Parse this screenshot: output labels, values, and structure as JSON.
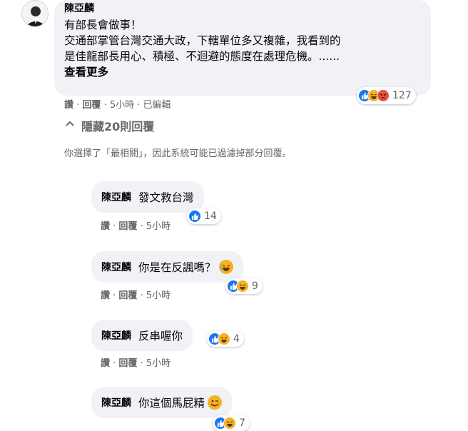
{
  "main_comment": {
    "author": "陳亞麟",
    "lines": [
      "有部長會做事！",
      "交通部掌管台灣交通大政，下轄單位多又複雜，我看到的",
      "是佳龍部長用心、積極、不迴避的態度在處理危機。......"
    ],
    "see_more": "查看更多",
    "actions": {
      "like": "讚",
      "reply": "回覆",
      "time": "5小時",
      "edited": "已編輯"
    },
    "reaction_count": "127"
  },
  "hide_replies": "隱藏20則回覆",
  "filter_notice": "你選擇了「最相關」，因此系統可能已過濾掉部分回覆。",
  "replies": [
    {
      "author": "陳亞麟",
      "text": "發文救台灣",
      "actions": {
        "like": "讚",
        "reply": "回覆",
        "time": "5小時"
      },
      "reaction_count": "14"
    },
    {
      "author": "陳亞麟",
      "text": "你是在反諷嗎？",
      "actions": {
        "like": "讚",
        "reply": "回覆",
        "time": "5小時"
      },
      "reaction_count": "9"
    },
    {
      "author": "陳亞麟",
      "text": "反串喔你",
      "actions": {
        "like": "讚",
        "reply": "回覆",
        "time": "5小時"
      },
      "reaction_count": "4"
    },
    {
      "author": "陳亞麟",
      "text": "你這個馬屁精",
      "reaction_count": "7"
    }
  ],
  "colors": {
    "bubble_bg": "#f0f2f5",
    "meta_text": "#65676b",
    "like_blue": "#1877f2",
    "haha_yellow": "#f7b125",
    "angry_red": "#e8513f"
  },
  "icons": [
    "avatar",
    "like-icon",
    "haha-icon",
    "angry-icon",
    "chevron-up-icon",
    "laughing-emoji-icon",
    "winking-emoji-icon"
  ]
}
